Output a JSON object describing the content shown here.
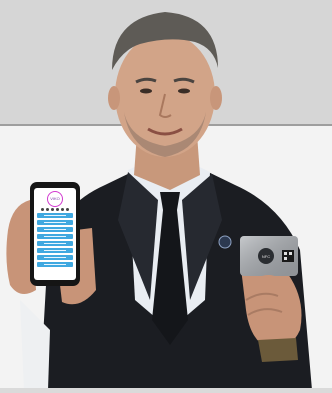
{
  "image": {
    "description_colors": {
      "top_background": "#d6d6d6",
      "bottom_background": "#f3f3f3",
      "suit": "#1b1d22",
      "shirt": "#e9edf2",
      "tie": "#14161a",
      "phone_screen_accent": "#3fa8e0",
      "card": "#a9adb2"
    },
    "icons": [
      "phone",
      "nfc-card",
      "qr-code",
      "lapel-pin"
    ],
    "phone_screen": {
      "button_count": 8,
      "logo_text": "VIKO"
    },
    "card": {
      "nfc_label": "NFC"
    }
  }
}
